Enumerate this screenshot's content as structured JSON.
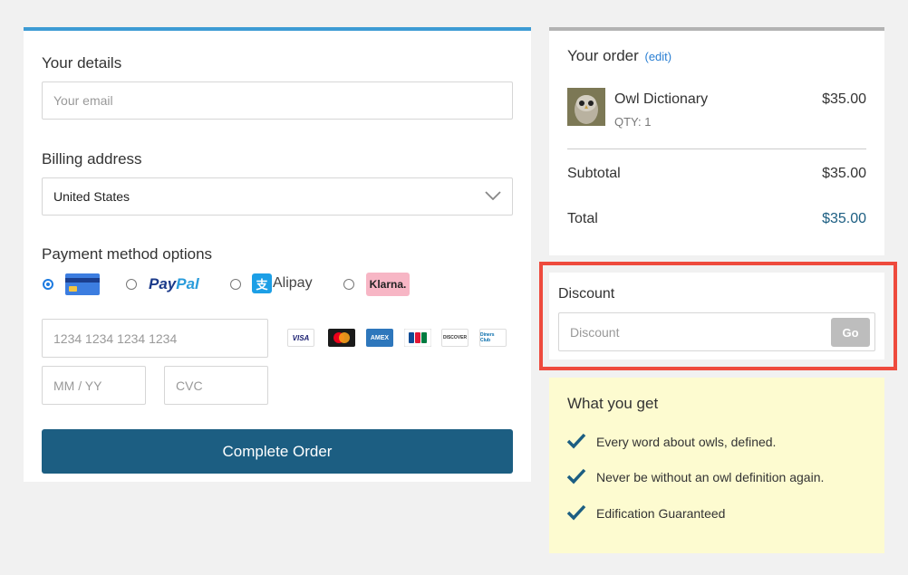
{
  "details": {
    "title": "Your details",
    "email_placeholder": "Your email"
  },
  "billing": {
    "title": "Billing address",
    "country": "United States"
  },
  "payment": {
    "title": "Payment method options",
    "methods": [
      {
        "name": "card",
        "selected": true
      },
      {
        "name": "PayPal",
        "selected": false
      },
      {
        "name": "Alipay",
        "selected": false
      },
      {
        "name": "Klarna.",
        "selected": false
      }
    ],
    "paypal_text_1": "Pay",
    "paypal_text_2": "Pal",
    "alipay_text": "Alipay",
    "klarna_text": "Klarna.",
    "card_number_placeholder": "1234 1234 1234 1234",
    "expiry_placeholder": "MM / YY",
    "cvc_placeholder": "CVC",
    "card_brands": [
      "VISA",
      "mastercard",
      "AMEX",
      "JCB",
      "DISCOVER",
      "Diners Club"
    ],
    "visa_label": "VISA",
    "amex_label": "AMEX",
    "discover_label": "DISCOVER",
    "diners_label": "Diners Club"
  },
  "complete_button": "Complete Order",
  "order": {
    "title": "Your order",
    "edit_label": "(edit)",
    "product_name": "Owl Dictionary",
    "product_qty": "QTY: 1",
    "product_price": "$35.00",
    "subtotal_label": "Subtotal",
    "subtotal_value": "$35.00",
    "total_label": "Total",
    "total_value": "$35.00"
  },
  "discount": {
    "title": "Discount",
    "placeholder": "Discount",
    "go_label": "Go"
  },
  "benefits": {
    "title": "What you get",
    "items": [
      "Every word about owls, defined.",
      "Never be without an owl definition again.",
      "Edification Guaranteed"
    ]
  },
  "colors": {
    "accent_blue": "#3d9bd4",
    "button_dark": "#1c5e82",
    "total_color": "#1c5e82",
    "highlight_red": "#ee4a3d",
    "benefits_bg": "#fdfbd0"
  }
}
